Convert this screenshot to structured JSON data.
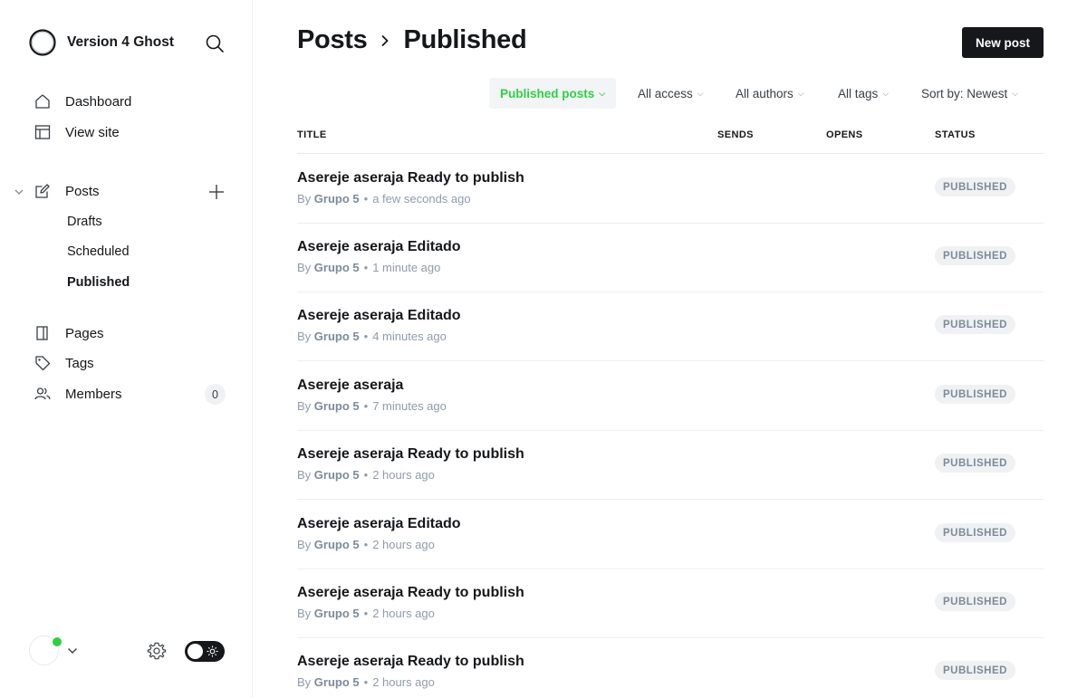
{
  "sidebar": {
    "site_name": "Version 4 Ghost",
    "nav": {
      "dashboard": "Dashboard",
      "view_site": "View site",
      "posts": "Posts",
      "drafts": "Drafts",
      "scheduled": "Scheduled",
      "published": "Published",
      "pages": "Pages",
      "tags": "Tags",
      "members": "Members",
      "members_count": "0"
    }
  },
  "header": {
    "breadcrumb_parent": "Posts",
    "title": "Published",
    "new_post_label": "New post"
  },
  "filters": {
    "type": "Published posts",
    "access": "All access",
    "authors": "All authors",
    "tags": "All tags",
    "sort": "Sort by: Newest"
  },
  "table": {
    "columns": {
      "title": "TITLE",
      "sends": "SENDS",
      "opens": "OPENS",
      "status": "STATUS"
    },
    "rows": [
      {
        "title": "Asereje aseraja Ready to publish",
        "by": "By",
        "author": "Grupo 5",
        "time": "a few seconds ago",
        "status": "PUBLISHED"
      },
      {
        "title": "Asereje aseraja Editado",
        "by": "By",
        "author": "Grupo 5",
        "time": "1 minute ago",
        "status": "PUBLISHED"
      },
      {
        "title": "Asereje aseraja Editado",
        "by": "By",
        "author": "Grupo 5",
        "time": "4 minutes ago",
        "status": "PUBLISHED"
      },
      {
        "title": "Asereje aseraja",
        "by": "By",
        "author": "Grupo 5",
        "time": "7 minutes ago",
        "status": "PUBLISHED"
      },
      {
        "title": "Asereje aseraja Ready to publish",
        "by": "By",
        "author": "Grupo 5",
        "time": "2 hours ago",
        "status": "PUBLISHED"
      },
      {
        "title": "Asereje aseraja Editado",
        "by": "By",
        "author": "Grupo 5",
        "time": "2 hours ago",
        "status": "PUBLISHED"
      },
      {
        "title": "Asereje aseraja Ready to publish",
        "by": "By",
        "author": "Grupo 5",
        "time": "2 hours ago",
        "status": "PUBLISHED"
      },
      {
        "title": "Asereje aseraja Ready to publish",
        "by": "By",
        "author": "Grupo 5",
        "time": "2 hours ago",
        "status": "PUBLISHED"
      }
    ]
  },
  "colors": {
    "accent_green": "#30cf43",
    "primary_dark": "#15171a",
    "badge_bg": "#eff1f3",
    "muted_text": "#8e9cac"
  }
}
